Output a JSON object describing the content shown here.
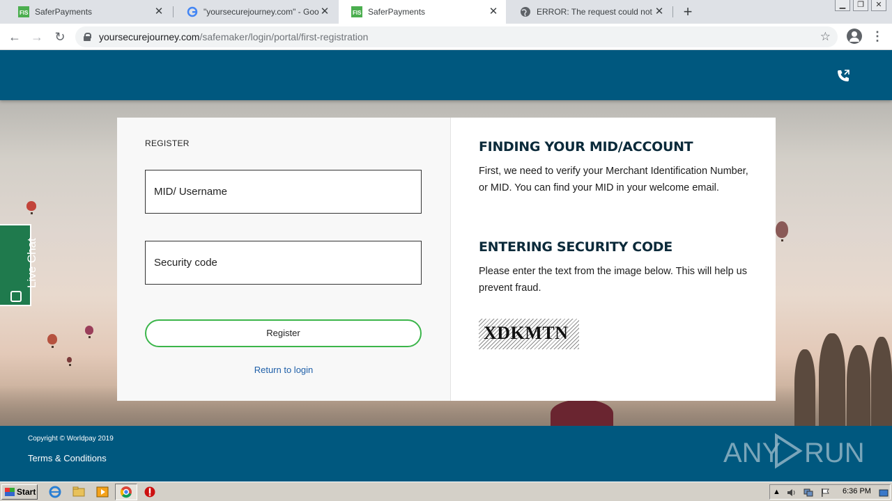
{
  "browser": {
    "tabs": [
      {
        "title": "SaferPayments",
        "favicon": "fis-icon",
        "active": false
      },
      {
        "title": "\"yoursecurejourney.com\" - Google Se",
        "favicon": "google-icon",
        "active": false
      },
      {
        "title": "SaferPayments",
        "favicon": "fis-icon",
        "active": true
      },
      {
        "title": "ERROR: The request could not be sa",
        "favicon": "globe-icon",
        "active": false
      }
    ],
    "url_host": "yoursecurejourney.com",
    "url_path": "/safemaker/login/portal/first-registration"
  },
  "form": {
    "heading": "REGISTER",
    "mid_placeholder": "MID/ Username",
    "security_placeholder": "Security code",
    "register_label": "Register",
    "return_link": "Return to login"
  },
  "info": {
    "heading1": "FINDING YOUR MID/ACCOUNT",
    "text1": "First, we need to verify your Merchant Identification Number, or MID. You can find your MID in your welcome email.",
    "heading2": "ENTERING SECURITY CODE",
    "text2": "Please enter the text from the image below. This will help us prevent fraud.",
    "captcha": "XDKMTN"
  },
  "livechat": {
    "label": "Live Chat"
  },
  "footer": {
    "copyright": "Copyright © Worldpay 2019",
    "terms": "Terms & Conditions"
  },
  "watermark": {
    "left": "ANY",
    "right": "RUN"
  },
  "taskbar": {
    "start": "Start",
    "clock": "6:36 PM"
  },
  "colors": {
    "header": "#00587f",
    "register_border": "#3bb54a",
    "livechat": "#1f7a4d"
  }
}
